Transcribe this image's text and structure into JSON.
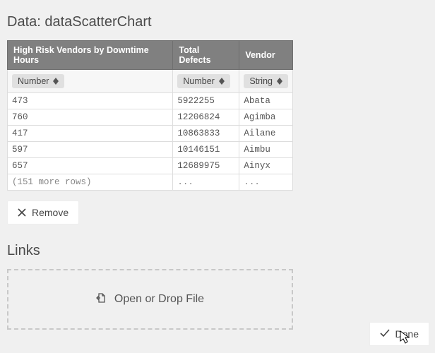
{
  "data_section": {
    "title": "Data: dataScatterChart",
    "columns": [
      "High Risk Vendors by Downtime Hours",
      "Total Defects",
      "Vendor"
    ],
    "types": [
      "Number",
      "Number",
      "String"
    ],
    "rows": [
      {
        "c0": "473",
        "c1": "5922255",
        "c2": "Abata"
      },
      {
        "c0": "760",
        "c1": "12206824",
        "c2": "Agimba"
      },
      {
        "c0": "417",
        "c1": "10863833",
        "c2": "Ailane"
      },
      {
        "c0": "597",
        "c1": "10146151",
        "c2": "Aimbu"
      },
      {
        "c0": "657",
        "c1": "12689975",
        "c2": "Ainyx"
      }
    ],
    "more_rows": "(151 more rows)",
    "ellipsis": "...",
    "remove_label": "Remove"
  },
  "links_section": {
    "title": "Links",
    "dropzone_label": "Open or Drop File"
  },
  "footer": {
    "done_label": "Done"
  }
}
